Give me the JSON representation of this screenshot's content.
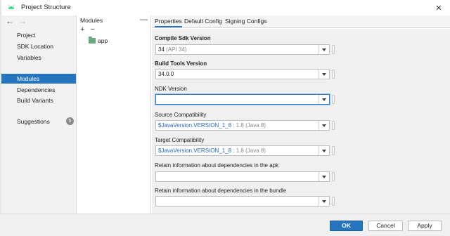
{
  "window": {
    "title": "Project Structure"
  },
  "sidebar": {
    "items": [
      {
        "label": "Project"
      },
      {
        "label": "SDK Location"
      },
      {
        "label": "Variables"
      },
      {
        "label": "Modules"
      },
      {
        "label": "Dependencies"
      },
      {
        "label": "Build Variants"
      },
      {
        "label": "Suggestions",
        "badge": "5"
      }
    ],
    "selected": "Modules"
  },
  "modules": {
    "header": "Modules",
    "add_symbol": "+",
    "remove_symbol": "−",
    "collapse_symbol": "—",
    "items": [
      {
        "label": "app"
      }
    ]
  },
  "tabs": [
    {
      "label": "Properties",
      "active": true
    },
    {
      "label": "Default Config",
      "active": false
    },
    {
      "label": "Signing Configs",
      "active": false
    }
  ],
  "form": {
    "compile_sdk": {
      "label": "Compile Sdk Version",
      "value": "34",
      "hint": "(API 34)"
    },
    "build_tools": {
      "label": "Build Tools Version",
      "value": "34.0.0"
    },
    "ndk": {
      "label": "NDK Version",
      "value": ""
    },
    "source_compat": {
      "label": "Source Compatibility",
      "value": "$JavaVersion.VERSION_1_8",
      "hint": ": 1.8 (Java 8)"
    },
    "target_compat": {
      "label": "Target Compatibility",
      "value": "$JavaVersion.VERSION_1_8",
      "hint": ": 1.8 (Java 8)"
    },
    "retain_apk": {
      "label": "Retain information about dependencies in the apk",
      "value": ""
    },
    "retain_bundle": {
      "label": "Retain information about dependencies in the bundle",
      "value": ""
    }
  },
  "footer": {
    "ok_label": "OK",
    "cancel_label": "Cancel",
    "apply_label": "Apply"
  },
  "colors": {
    "accent": "#2675bf",
    "android_green": "#3ddc84",
    "folder_green": "#6aa77a",
    "link_blue": "#2566c4"
  },
  "icons": [
    "android-icon",
    "close-icon",
    "back-arrow-icon",
    "forward-arrow-icon",
    "add-icon",
    "remove-icon",
    "collapse-icon",
    "module-folder-icon",
    "dropdown-arrow-icon"
  ]
}
